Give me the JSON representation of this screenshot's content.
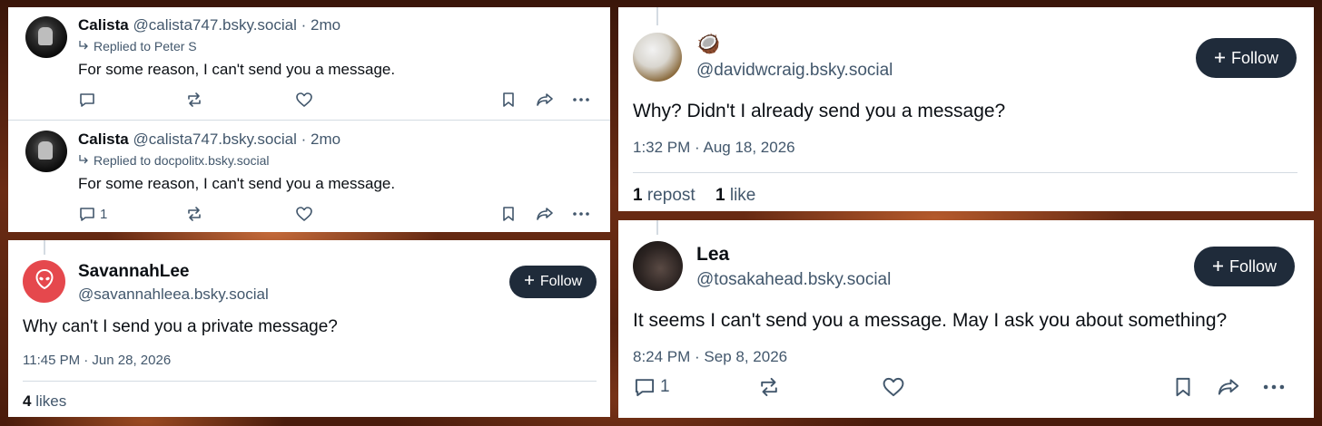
{
  "panel1": {
    "posts": [
      {
        "name": "Calista",
        "handle": "@calista747.bsky.social",
        "sep": "·",
        "time": "2mo",
        "replied_to": "Replied to Peter S",
        "text": "For some reason, I can't send you a message.",
        "reply_count": ""
      },
      {
        "name": "Calista",
        "handle": "@calista747.bsky.social",
        "sep": "·",
        "time": "2mo",
        "replied_to": "Replied to docpolitx.bsky.social",
        "text": "For some reason, I can't send you a message.",
        "reply_count": "1"
      }
    ]
  },
  "panel2": {
    "name": "SavannahLee",
    "handle": "@savannahleea.bsky.social",
    "follow_label": "Follow",
    "text": "Why can't I send you a private message?",
    "timestamp": "11:45 PM · Jun 28, 2026",
    "likes_count": "4",
    "likes_label": "likes"
  },
  "panel3": {
    "name": "🥥",
    "handle": "@davidwcraig.bsky.social",
    "follow_label": "Follow",
    "text": "Why? Didn't I already send you a message?",
    "timestamp": "1:32 PM · Aug 18, 2026",
    "repost_count": "1",
    "repost_label": "repost",
    "like_count": "1",
    "like_label": "like"
  },
  "panel4": {
    "name": "Lea",
    "handle": "@tosakahead.bsky.social",
    "follow_label": "Follow",
    "text": "It seems I can't send you a message. May I ask you about something?",
    "timestamp": "8:24 PM · Sep 8, 2026",
    "reply_count": "1"
  },
  "colors": {
    "follow_bg": "#1f2b3a",
    "muted_text": "#42576c",
    "divider": "#d4dbe2",
    "avatar_red": "#e5484d"
  },
  "icons": [
    "reply-icon",
    "repost-icon",
    "like-icon",
    "bookmark-icon",
    "share-icon",
    "more-icon",
    "plus-icon",
    "reply-arrow-icon",
    "alien-icon"
  ]
}
